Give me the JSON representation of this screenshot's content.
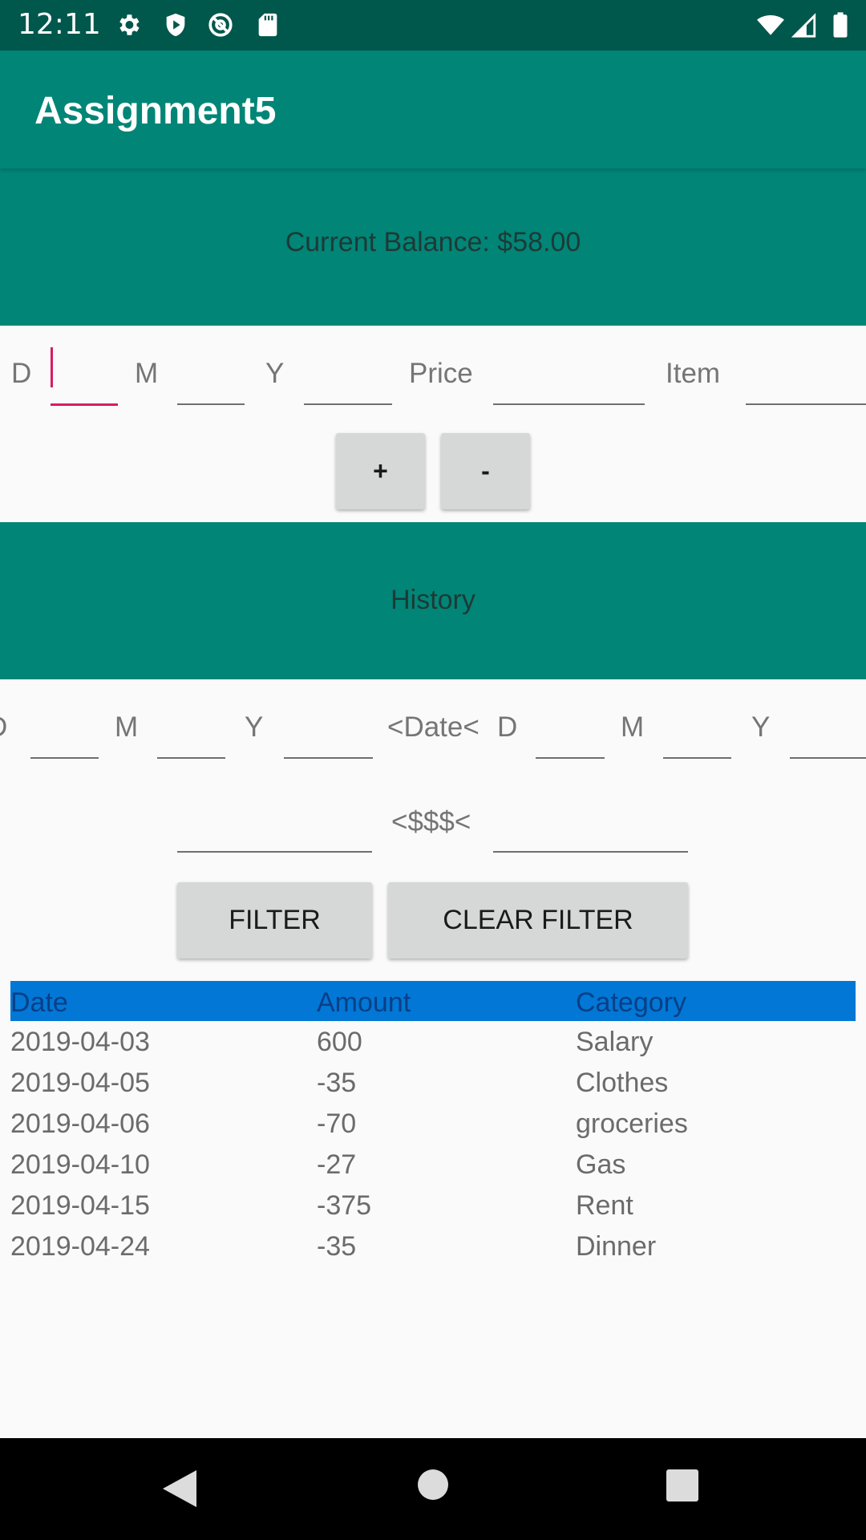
{
  "status_bar": {
    "time": "12:11",
    "icons": [
      "gear-icon",
      "shield-icon",
      "at-sign-icon",
      "sd-card-icon",
      "wifi-icon",
      "signal-icon",
      "battery-icon"
    ]
  },
  "app_bar": {
    "title": "Assignment5"
  },
  "balance": {
    "text": "Current Balance: $58.00"
  },
  "entry": {
    "day_label": "D",
    "month_label": "M",
    "year_label": "Y",
    "price_label": "Price",
    "item_label": "Item",
    "day_value": "",
    "month_value": "",
    "year_value": "",
    "price_value": "",
    "item_value": "",
    "add_label": "+",
    "subtract_label": "-"
  },
  "history": {
    "title": "History",
    "from_day_label": "D",
    "from_month_label": "M",
    "from_year_label": "Y",
    "date_range_label": "<Date<",
    "to_day_label": "D",
    "to_month_label": "M",
    "to_year_label": "Y",
    "amount_range_label": "<$$$<",
    "filter_label": "FILTER",
    "clear_filter_label": "CLEAR FILTER"
  },
  "table": {
    "headers": [
      "Date",
      "Amount",
      "Category"
    ],
    "rows": [
      [
        "2019-04-03",
        "600",
        "Salary"
      ],
      [
        "2019-04-05",
        "-35",
        "Clothes"
      ],
      [
        "2019-04-06",
        "-70",
        "groceries"
      ],
      [
        "2019-04-10",
        "-27",
        "Gas"
      ],
      [
        "2019-04-15",
        "-375",
        "Rent"
      ],
      [
        "2019-04-24",
        "-35",
        "Dinner"
      ]
    ]
  },
  "colors": {
    "primary": "#008577",
    "primary_dark": "#00574b",
    "accent": "#d81b60",
    "table_header": "#0277d5"
  },
  "nav_bar": {
    "icons": [
      "back-icon",
      "home-icon",
      "recents-icon"
    ]
  }
}
